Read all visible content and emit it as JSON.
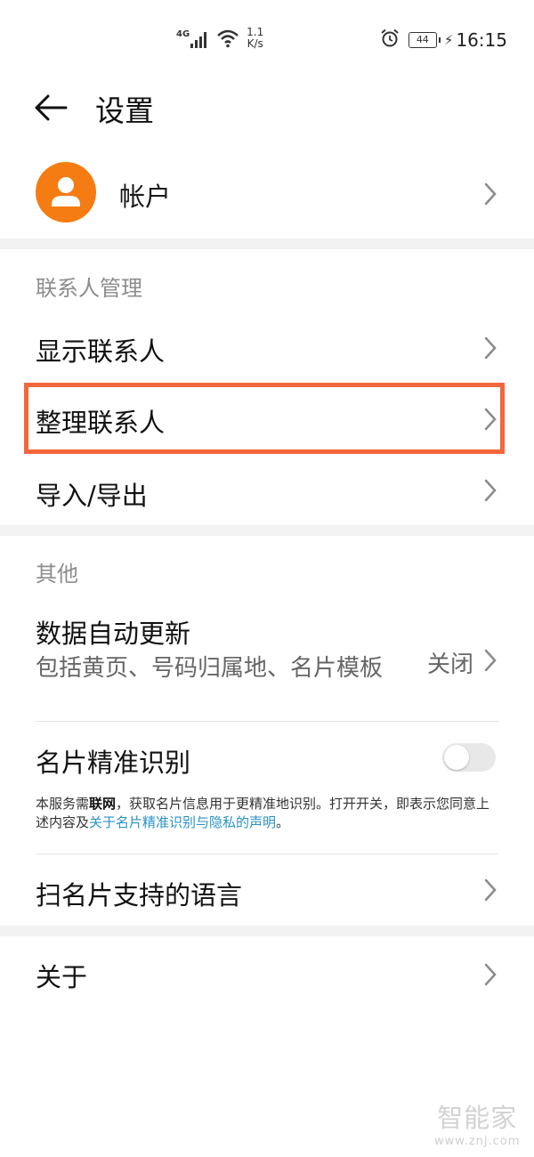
{
  "status_bar": {
    "network": "4G",
    "speed_value": "1.1",
    "speed_unit": "K/s",
    "battery": "44",
    "time": "16:15"
  },
  "header": {
    "title": "设置"
  },
  "account": {
    "label": "帐户",
    "avatar_color": "#f57c12"
  },
  "contacts_section": {
    "title": "联系人管理",
    "items": [
      {
        "label": "显示联系人"
      },
      {
        "label": "整理联系人"
      },
      {
        "label": "导入/导出"
      }
    ]
  },
  "other_section": {
    "title": "其他",
    "data_update": {
      "label": "数据自动更新",
      "sub": "包括黄页、号码归属地、名片模板",
      "value": "关闭"
    },
    "card_recognition": {
      "label": "名片精准识别",
      "enabled": false,
      "notice_part1": "本服务需",
      "notice_bold": "联网",
      "notice_part2": "，获取名片信息用于更精准地识别。打开开关，即表示您同意上述内容及",
      "notice_link": "关于名片精准识别与隐私的声明",
      "notice_end": "。"
    },
    "scan_languages": {
      "label": "扫名片支持的语言"
    }
  },
  "about": {
    "label": "关于"
  },
  "highlight_color": "#f4673c",
  "watermark": {
    "text": "智能家",
    "url": "www.znj.com"
  }
}
